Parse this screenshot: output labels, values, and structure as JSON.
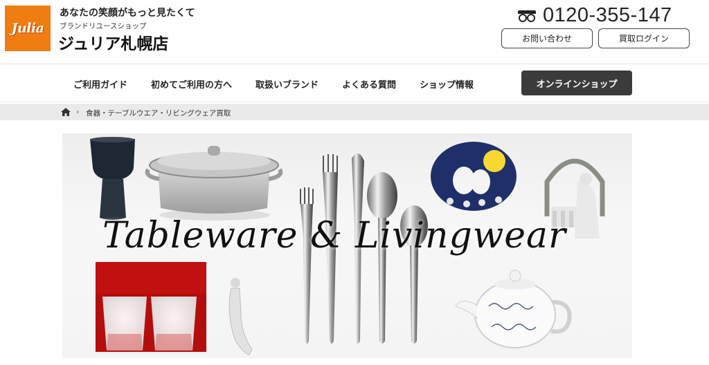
{
  "header": {
    "logo_text": "Julia",
    "tagline": "あなたの笑顔がもっと見たくて",
    "shop_type": "ブランドリユースショップ",
    "shop_name": "ジュリア札幌店",
    "phone_icon": "free-dial-icon",
    "phone": "0120-355-147",
    "contact_label": "お問い合わせ",
    "login_label": "買取ログイン"
  },
  "nav": {
    "items": [
      {
        "label": "ご利用ガイド"
      },
      {
        "label": "初めてご利用の方へ"
      },
      {
        "label": "取扱いブランド"
      },
      {
        "label": "よくある質問"
      },
      {
        "label": "ショップ情報"
      }
    ],
    "online_shop_label": "オンラインショップ"
  },
  "breadcrumb": {
    "home_icon": "home-icon",
    "current": "食器・テーブルウエア・リビングウェア買取"
  },
  "hero": {
    "title": "Tableware & Livingwear"
  },
  "colors": {
    "logo_bg": "#ef7d12",
    "nav_button": "#3b3b3b",
    "breadcrumb_bg": "#eaeaea"
  }
}
